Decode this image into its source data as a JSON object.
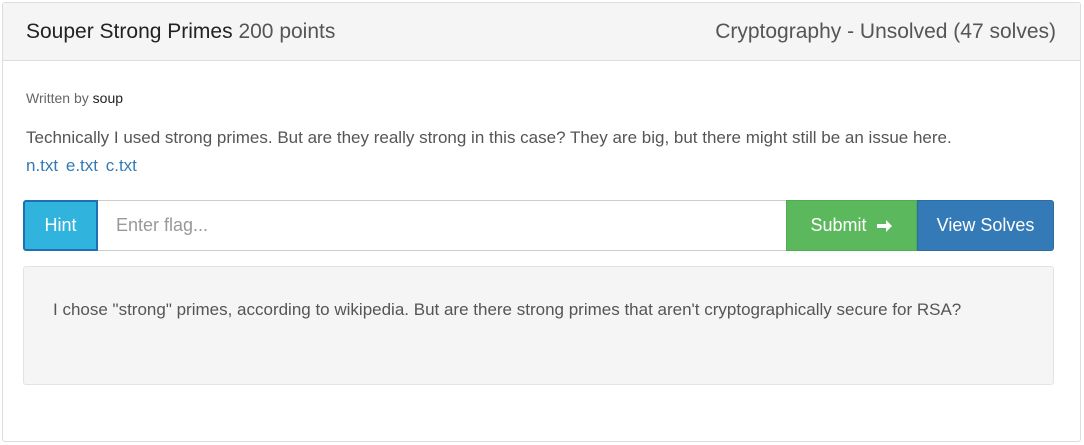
{
  "challenge": {
    "name": "Souper Strong Primes",
    "points": "200 points",
    "category_status": "Cryptography - Unsolved (47 solves)",
    "written_by_label": "Written by",
    "author": "soup",
    "description": "Technically I used strong primes. But are they really strong in this case? They are big, but there might still be an issue here.",
    "files": [
      "n.txt",
      "e.txt",
      "c.txt"
    ]
  },
  "form": {
    "hint_label": "Hint",
    "flag_placeholder": "Enter flag...",
    "flag_value": "",
    "submit_label": "Submit",
    "view_solves_label": "View Solves"
  },
  "hint": {
    "text": "I chose \"strong\" primes, according to wikipedia. But are there strong primes that aren't cryptographically secure for RSA?"
  },
  "colors": {
    "hint_button": "#30b4dd",
    "submit_button": "#5cb85c",
    "view_solves_button": "#337ab7",
    "link": "#337ab7",
    "heading_bg": "#f5f5f5"
  },
  "icons": {
    "submit": "arrow-right-icon"
  }
}
